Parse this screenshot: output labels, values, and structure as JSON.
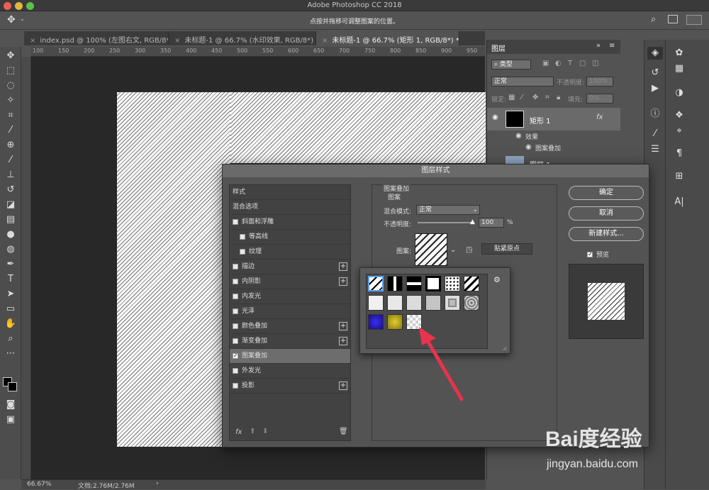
{
  "app": {
    "title": "Adobe Photoshop CC 2018"
  },
  "options_bar": {
    "hint": "点按并拖移可调整图案的位置。"
  },
  "tabs": [
    {
      "label": "index.psd @ 100% (左图右文, RGB/8*)"
    },
    {
      "label": "未标题-1 @ 66.7% (水印效果, RGB/8*) *"
    },
    {
      "label": "未标题-1 @ 66.7% (矩形 1, RGB/8*) *"
    }
  ],
  "ruler": {
    "ticks": [
      "100",
      "150",
      "200",
      "250",
      "300",
      "350",
      "400",
      "450",
      "500",
      "550",
      "600",
      "650",
      "700",
      "750",
      "800",
      "850",
      "900",
      "950"
    ]
  },
  "status": {
    "zoom": "66.67%",
    "doc": "文档:2.76M/2.76M"
  },
  "layers_panel": {
    "tab": "图层",
    "filter_label": "类型",
    "blend": "正常",
    "opacity_label": "不透明度:",
    "opacity_value": "100%",
    "lock_label": "锁定:",
    "fill_label": "填充:",
    "fill_value": "0%",
    "layer1_name": "矩形 1",
    "fx_label": "fx",
    "effects_label": "效果",
    "effect_pattern": "图案叠加",
    "layer2_name": "图层 1"
  },
  "dialog": {
    "title": "图层样式",
    "styles": [
      {
        "label": "样式"
      },
      {
        "label": "混合选项"
      },
      {
        "label": "斜面和浮雕"
      },
      {
        "label": "等高线"
      },
      {
        "label": "纹理"
      },
      {
        "label": "描边"
      },
      {
        "label": "内阴影"
      },
      {
        "label": "内发光"
      },
      {
        "label": "光泽"
      },
      {
        "label": "颜色叠加"
      },
      {
        "label": "渐变叠加"
      },
      {
        "label": "图案叠加"
      },
      {
        "label": "外发光"
      },
      {
        "label": "投影"
      }
    ],
    "section_title": "图案叠加",
    "group_title": "图案",
    "blend_label": "混合模式:",
    "blend_value": "正常",
    "opacity_label": "不透明度:",
    "opacity_value": "100",
    "opacity_unit": "%",
    "pattern_label": "图案:",
    "snap_button": "贴紧原点",
    "fx_label": "fx",
    "ok": "确定",
    "cancel": "取消",
    "new_style": "新建样式...",
    "preview_label": "预览"
  },
  "watermark": {
    "logo": "Bai度经验",
    "url": "jingyan.baidu.com"
  },
  "colors": {
    "accent": "#e8334a",
    "panel": "#535353",
    "canvas": "#282828"
  }
}
